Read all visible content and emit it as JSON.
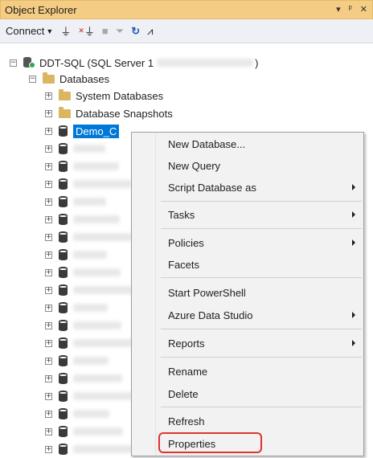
{
  "window": {
    "title": "Object Explorer",
    "controls": [
      "▾",
      "ᵖ",
      "✕"
    ]
  },
  "toolbar": {
    "connect_label": "Connect"
  },
  "tree": {
    "server_label": "DDT-SQL (SQL Server 1",
    "databases_label": "Databases",
    "system_databases_label": "System Databases",
    "snapshots_label": "Database Snapshots",
    "selected_db_label": "Demo_C"
  },
  "context_menu": {
    "items": [
      {
        "label": "New Database..."
      },
      {
        "label": "New Query"
      },
      {
        "label": "Script Database as"
      },
      {
        "label": "Tasks"
      },
      {
        "label": "Policies"
      },
      {
        "label": "Facets"
      },
      {
        "label": "Start PowerShell"
      },
      {
        "label": "Azure Data Studio"
      },
      {
        "label": "Reports"
      },
      {
        "label": "Rename"
      },
      {
        "label": "Delete"
      },
      {
        "label": "Refresh"
      },
      {
        "label": "Properties"
      }
    ]
  },
  "colors": {
    "titlebar": "#f5cc84",
    "selection": "#0078d7",
    "highlight": "#e0342e"
  }
}
